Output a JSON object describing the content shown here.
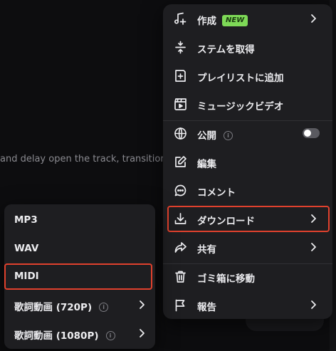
{
  "background": {
    "track_text": "and delay open the track, transitioning"
  },
  "menu": {
    "items": [
      {
        "label": "作成",
        "badge": "NEW",
        "icon": "music-plus-icon"
      },
      {
        "label": "ステムを取得",
        "icon": "split-arrows-icon"
      },
      {
        "label": "プレイリストに追加",
        "icon": "add-to-playlist-icon"
      },
      {
        "label": "ミュージックビデオ",
        "icon": "clapperboard-icon"
      },
      {
        "label": "公開",
        "icon": "globe-icon",
        "info": "i",
        "toggle_on": false
      },
      {
        "label": "編集",
        "icon": "pencil-icon"
      },
      {
        "label": "コメント",
        "icon": "comment-icon"
      },
      {
        "label": "ダウンロード",
        "icon": "download-icon"
      },
      {
        "label": "共有",
        "icon": "share-icon"
      },
      {
        "label": "ゴミ箱に移動",
        "icon": "trash-icon"
      },
      {
        "label": "報告",
        "icon": "flag-icon"
      }
    ]
  },
  "download_submenu": {
    "items": [
      {
        "label": "MP3"
      },
      {
        "label": "WAV"
      },
      {
        "label": "MIDI"
      },
      {
        "label": "歌詞動画 (720P)",
        "info": "i"
      },
      {
        "label": "歌詞動画 (1080P)",
        "info": "i"
      }
    ]
  },
  "colors": {
    "highlight": "#e0412d",
    "badge": "#7ed957",
    "menu_bg": "#1e1e21"
  }
}
